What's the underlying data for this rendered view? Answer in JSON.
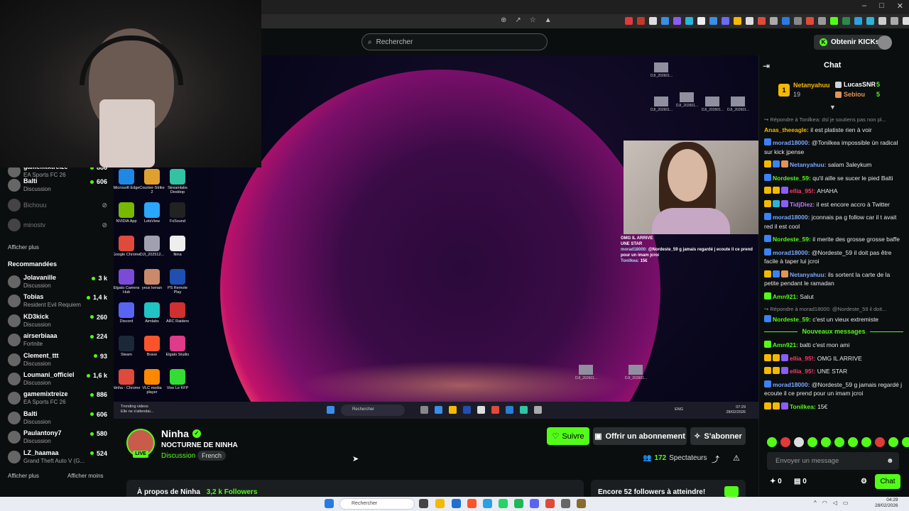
{
  "search": {
    "placeholder": "Rechercher"
  },
  "header": {
    "kicks_label": "Obtenir KICKs"
  },
  "sidebar": {
    "following": [
      {
        "name": "gamemixtreize",
        "sub": "EA Sports FC 26",
        "viewers": "886",
        "live": true
      },
      {
        "name": "Balti",
        "sub": "Discussion",
        "viewers": "606",
        "live": true
      },
      {
        "name": "Bichouu",
        "sub": "",
        "viewers": "",
        "live": false
      },
      {
        "name": "minostv",
        "sub": "",
        "viewers": "",
        "live": false
      }
    ],
    "show_more_1": "Afficher plus",
    "recommended_heading": "Recommandées",
    "recommended": [
      {
        "name": "Jolavanille",
        "sub": "Discussion",
        "viewers": "3 k"
      },
      {
        "name": "Tobias",
        "sub": "Resident Evil Requiem",
        "viewers": "1,4 k"
      },
      {
        "name": "KD3kick",
        "sub": "Discussion",
        "viewers": "260"
      },
      {
        "name": "airserbiaaa",
        "sub": "Fortnite",
        "viewers": "224"
      },
      {
        "name": "Clement_ttt",
        "sub": "Discussion",
        "viewers": "93"
      },
      {
        "name": "Loumani_officiel",
        "sub": "Discussion",
        "viewers": "1,6 k"
      },
      {
        "name": "gamemixtreize",
        "sub": "EA Sports FC 26",
        "viewers": "886"
      },
      {
        "name": "Balti",
        "sub": "Discussion",
        "viewers": "606"
      },
      {
        "name": "Paulantony7",
        "sub": "Discussion",
        "viewers": "580"
      },
      {
        "name": "LZ_haamaa",
        "sub": "Grand Theft Auto V (G...",
        "viewers": "524"
      }
    ],
    "show_more_2": "Afficher plus",
    "show_less": "Afficher moins"
  },
  "video": {
    "desktop_icons": [
      {
        "label": "Microsoft Edge",
        "color": "#1e88e5"
      },
      {
        "label": "Counter-Strike 2",
        "color": "#e0a030"
      },
      {
        "label": "Streamlabs Desktop",
        "color": "#31c3a2"
      },
      {
        "label": "NVIDIA App",
        "color": "#76b900"
      },
      {
        "label": "LetsView",
        "color": "#2aa6ff"
      },
      {
        "label": "FxSound",
        "color": "#222222"
      },
      {
        "label": "Google Chrome",
        "color": "#e04a3a"
      },
      {
        "label": "DJI_202512...",
        "color": "#a0a0b0"
      },
      {
        "label": "fiiina",
        "color": "#eeeeee"
      },
      {
        "label": "Elgato Camera Hub",
        "color": "#7b4bd8"
      },
      {
        "label": "yeux kenan",
        "color": "#c88a6a"
      },
      {
        "label": "PS Remote Play",
        "color": "#1f4fb0"
      },
      {
        "label": "Discord",
        "color": "#5865f2"
      },
      {
        "label": "Aimlabs",
        "color": "#20c4c4"
      },
      {
        "label": "ARC Raiders",
        "color": "#d03030"
      },
      {
        "label": "Steam",
        "color": "#1b2838"
      },
      {
        "label": "Brave",
        "color": "#fb542b"
      },
      {
        "label": "Elgato Studio",
        "color": "#e03a8a"
      },
      {
        "label": "Ninha - Chrome",
        "color": "#e04a3a"
      },
      {
        "label": "VLC media player",
        "color": "#ff8800"
      },
      {
        "label": "Vive Le KFP",
        "color": "#33dd33"
      }
    ],
    "thumbs": [
      "DJI_202601...",
      "DJI_202601...",
      "DJI_202601...",
      "DJI_202601...",
      "DJI_202601...",
      "DJI_202601...",
      "DJI_202601..."
    ],
    "overlay_chat": [
      {
        "user": "",
        "text": "OMG IL ARRIVE"
      },
      {
        "user": "",
        "text": "UNE STAR"
      },
      {
        "user": "morad18000:",
        "text": "@Nordeste_59 g jamais regardé j ecoute il ce prend pour un imam jcroi"
      },
      {
        "user": "Tonilkea:",
        "text": "15€"
      }
    ],
    "taskbar_trend": "Trending videos",
    "taskbar_trend_sub": "Elle ne s'attendai...",
    "taskbar_search": "Rechercher",
    "taskbar_lang": "ENG",
    "taskbar_time": "07:29",
    "taskbar_date": "28/02/2026"
  },
  "channel": {
    "name": "Ninha",
    "title": "NOCTURNE DE NINHA",
    "category": "Discussion",
    "language": "French",
    "live_badge": "LIVE",
    "follow_label": "Suivre",
    "gift_label": "Offrir un abonnement",
    "subscribe_label": "S'abonner",
    "viewers_count": "172",
    "viewers_label": "Spectateurs",
    "about_label": "À propos de Ninha",
    "followers_label": "3,2 k Followers",
    "goal_label": "Encore 52 followers à atteindre!"
  },
  "chat": {
    "title": "Chat",
    "leaderboard": {
      "first_name": "Netanyahuu",
      "first_count": "19",
      "second_name": "LucasSNR",
      "second_count": "5",
      "third_name": "Sebiou",
      "third_count": "5"
    },
    "messages_before": [
      {
        "type": "reply",
        "text": "Répondre à Tonilkea: dsl je soutiens pas non pl..."
      },
      {
        "user": "Anas_theeagle:",
        "color": "#f5b900",
        "text": "il est platiste rien à voir",
        "badges": []
      },
      {
        "user": "morad18000:",
        "color": "#7aa7ff",
        "text": "@Tonilkea impossible ùn radical sur kick jpense",
        "badges": [
          "#3b82f6"
        ]
      },
      {
        "user": "Netanyahuu:",
        "color": "#7aa7ff",
        "text": "salam 3aleykum",
        "badges": [
          "#f5b900",
          "#3b82f6",
          "#e29454"
        ]
      },
      {
        "user": "Nordeste_59:",
        "color": "#53fc18",
        "text": "qu'il aille se sucer le pied Balti",
        "badges": [
          "#3b82f6"
        ]
      },
      {
        "user": "ellia_95!:",
        "color": "#ff3a6a",
        "text": "AHAHA",
        "badges": [
          "#f5b900",
          "#f5b900",
          "#8b5cf6"
        ]
      },
      {
        "user": "TidjDiez:",
        "color": "#c07aff",
        "text": "il est encore accro à Twitter",
        "badges": [
          "#f5b900",
          "#2bb5d8",
          "#8b5cf6"
        ]
      },
      {
        "user": "morad18000:",
        "color": "#7aa7ff",
        "text": "jconnais pa g follow car il t avait red il est cool",
        "badges": [
          "#3b82f6"
        ]
      },
      {
        "user": "Nordeste_59:",
        "color": "#53fc18",
        "text": "il merite des grosse grosse baffe",
        "badges": [
          "#3b82f6"
        ]
      },
      {
        "user": "morad18000:",
        "color": "#7aa7ff",
        "text": "@Nordeste_59 il doit pas être facile à taper lui jcroi",
        "badges": [
          "#3b82f6"
        ]
      },
      {
        "user": "Netanyahuu:",
        "color": "#7aa7ff",
        "text": "ils sortent la carte de la petite pendant le ramadan",
        "badges": [
          "#f5b900",
          "#3b82f6",
          "#e29454"
        ]
      },
      {
        "user": "Amn921:",
        "color": "#53fc18",
        "text": "Salut",
        "badges": [
          "#53fc18"
        ]
      },
      {
        "type": "reply",
        "text": "Répondre à morad18000: @Nordeste_59 il doit..."
      },
      {
        "user": "Nordeste_59:",
        "color": "#53fc18",
        "text": "c'est un vieux extremiste",
        "badges": [
          "#3b82f6"
        ]
      }
    ],
    "new_messages_label": "Nouveaux messages",
    "messages_after": [
      {
        "user": "Amn921:",
        "color": "#53fc18",
        "text": "balti c'est mon ami",
        "badges": [
          "#53fc18"
        ]
      },
      {
        "user": "ellia_95!:",
        "color": "#ff3a6a",
        "text": "OMG IL ARRIVE",
        "badges": [
          "#f5b900",
          "#f5b900",
          "#8b5cf6"
        ]
      },
      {
        "user": "ellia_95!:",
        "color": "#ff3a6a",
        "text": "UNE STAR",
        "badges": [
          "#f5b900",
          "#f5b900",
          "#8b5cf6"
        ]
      },
      {
        "user": "morad18000:",
        "color": "#7aa7ff",
        "text": "@Nordeste_59 g jamais regardé j ecoute il ce prend pour un imam jcroi",
        "badges": [
          "#3b82f6"
        ]
      },
      {
        "user": "Tonilkea:",
        "color": "#53fc18",
        "text": "15€",
        "badges": [
          "#f5b900",
          "#f5b900",
          "#8b5cf6"
        ]
      }
    ],
    "input_placeholder": "Envoyer un message",
    "points_1": "0",
    "points_2": "0",
    "send_label": "Chat"
  },
  "os": {
    "search": "Rechercher",
    "time": "04:29",
    "date": "28/02/2026"
  }
}
